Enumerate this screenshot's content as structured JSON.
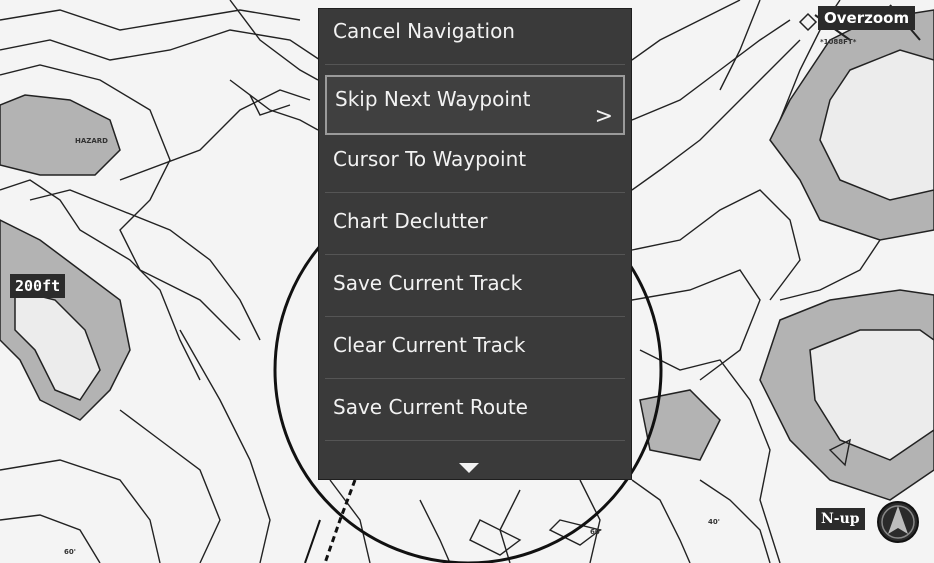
{
  "menu": {
    "items": [
      {
        "label": "Cancel Navigation",
        "selected": false
      },
      {
        "label": "Skip Next Waypoint",
        "selected": true,
        "submenu_indicator": ">"
      },
      {
        "label": "Cursor To Waypoint",
        "selected": false
      },
      {
        "label": "Chart Declutter",
        "selected": false
      },
      {
        "label": "Save Current Track",
        "selected": false
      },
      {
        "label": "Clear Current Track",
        "selected": false
      },
      {
        "label": "Save Current Route",
        "selected": false
      }
    ],
    "more_indicator": "down-arrow-icon"
  },
  "map": {
    "scale_label": "200ft",
    "overzoom_label": "Overzoom",
    "orientation_label": "N-up",
    "depth_labels": [
      "HAZARD",
      "*1088FT*",
      "60'",
      "40'",
      "60'"
    ]
  },
  "colors": {
    "menu_bg": "#3a3a3a",
    "menu_text": "#f2f2f2",
    "selected_border": "#9a9a9a",
    "land_shade": "#b3b3b3",
    "water": "#f4f4f4"
  }
}
